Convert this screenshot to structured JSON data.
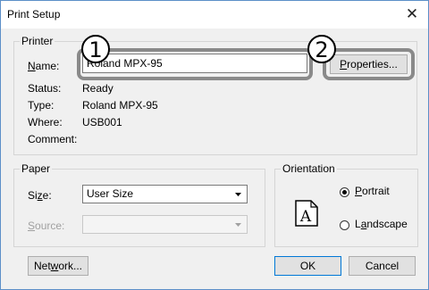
{
  "window": {
    "title": "Print Setup",
    "close_glyph": "✕"
  },
  "printer": {
    "group_label": "Printer",
    "name_label_prefix": "",
    "name_label_ul": "N",
    "name_label_rest": "ame:",
    "name_value": "Roland MPX-95",
    "properties_ul": "P",
    "properties_rest": "roperties...",
    "status_label": "Status:",
    "status_value": "Ready",
    "type_label": "Type:",
    "type_value": "Roland MPX-95",
    "where_label": "Where:",
    "where_value": "USB001",
    "comment_label": "Comment:"
  },
  "paper": {
    "group_label": "Paper",
    "size_label_pre": "Si",
    "size_label_ul": "z",
    "size_label_post": "e:",
    "size_value": "User Size",
    "source_label_ul": "S",
    "source_label_rest": "ource:",
    "source_value": ""
  },
  "orientation": {
    "group_label": "Orientation",
    "portrait_ul": "P",
    "portrait_rest": "ortrait",
    "landscape_pre": "L",
    "landscape_ul": "a",
    "landscape_rest": "ndscape",
    "selected": "portrait",
    "page_letter": "A"
  },
  "buttons": {
    "network_pre": "Net",
    "network_ul": "w",
    "network_rest": "ork...",
    "ok": "OK",
    "cancel": "Cancel"
  },
  "callouts": {
    "one": "1",
    "two": "2"
  }
}
